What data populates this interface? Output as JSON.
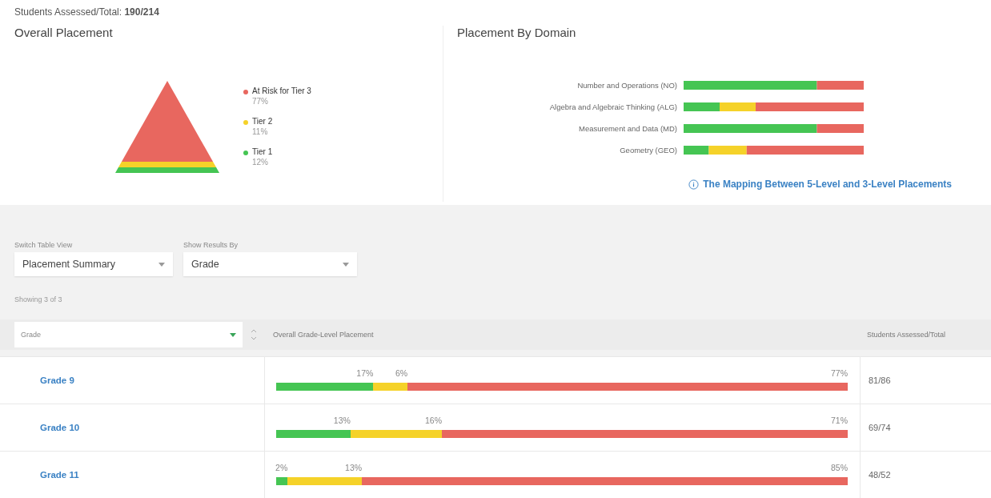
{
  "summary": {
    "label": "Students Assessed/Total:",
    "value": "190/214"
  },
  "overall": {
    "title": "Overall Placement",
    "legend": [
      {
        "label": "At Risk for Tier 3",
        "percent": "77%",
        "color": "#e8675f"
      },
      {
        "label": "Tier 2",
        "percent": "11%",
        "color": "#f5d229"
      },
      {
        "label": "Tier 1",
        "percent": "12%",
        "color": "#45c553"
      }
    ]
  },
  "domain": {
    "title": "Placement By Domain",
    "rows": [
      {
        "label": "Number and Operations (NO)"
      },
      {
        "label": "Algebra and Algebraic Thinking (ALG)"
      },
      {
        "label": "Measurement and Data (MD)"
      },
      {
        "label": "Geometry (GEO)"
      }
    ],
    "link": "The Mapping Between 5-Level and 3-Level Placements"
  },
  "controls": [
    {
      "label": "Switch Table View",
      "value": "Placement Summary"
    },
    {
      "label": "Show Results By",
      "value": "Grade"
    }
  ],
  "showing": "Showing 3 of 3",
  "table": {
    "sort_field": "Grade",
    "columns": [
      "Overall Grade-Level Placement",
      "Students Assessed/Total"
    ],
    "rows": [
      {
        "name": "Grade 9",
        "total": "81/86",
        "segments": [
          {
            "kind": "green",
            "label": "17%"
          },
          {
            "kind": "yellow",
            "label": "6%"
          },
          {
            "kind": "red",
            "label": "77%"
          }
        ]
      },
      {
        "name": "Grade 10",
        "total": "69/74",
        "segments": [
          {
            "kind": "green",
            "label": "13%"
          },
          {
            "kind": "yellow",
            "label": "16%"
          },
          {
            "kind": "red",
            "label": "71%"
          }
        ]
      },
      {
        "name": "Grade 11",
        "total": "48/52",
        "segments": [
          {
            "kind": "green",
            "label": "2%"
          },
          {
            "kind": "yellow",
            "label": "13%"
          },
          {
            "kind": "red",
            "label": "85%"
          }
        ]
      }
    ]
  }
}
